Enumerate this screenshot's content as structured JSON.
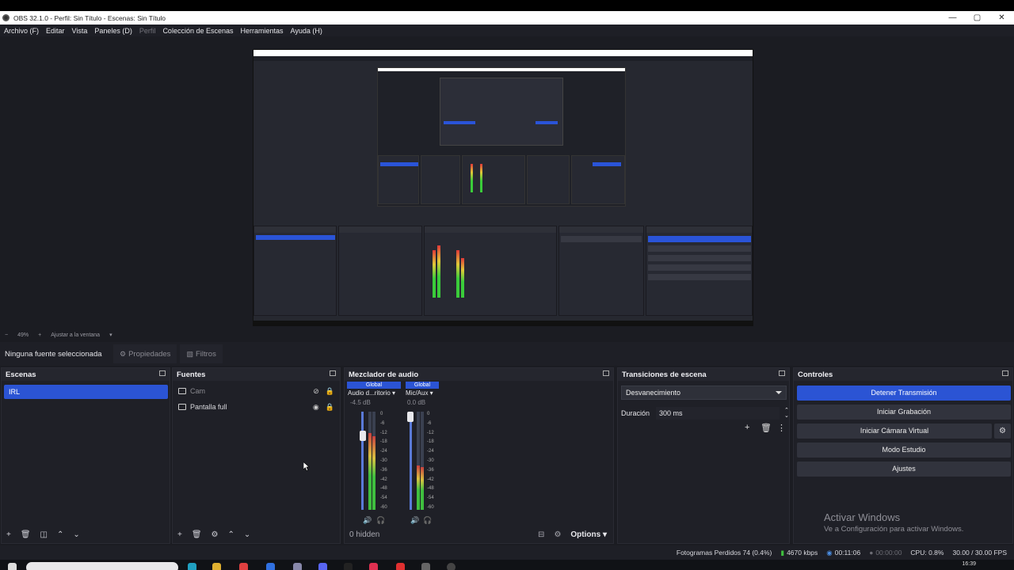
{
  "window": {
    "title": "OBS 32.1.0 - Perfil: Sin Título - Escenas: Sin Título",
    "controls": [
      "—",
      "▢",
      "✕"
    ]
  },
  "menu": [
    {
      "label": "Archivo (F)",
      "disabled": false
    },
    {
      "label": "Editar",
      "disabled": false
    },
    {
      "label": "Vista",
      "disabled": false
    },
    {
      "label": "Paneles (D)",
      "disabled": false
    },
    {
      "label": "Perfil",
      "disabled": true
    },
    {
      "label": "Colección de Escenas",
      "disabled": false
    },
    {
      "label": "Herramientas",
      "disabled": false
    },
    {
      "label": "Ayuda (H)",
      "disabled": false
    }
  ],
  "zoom": {
    "minus": "−",
    "level": "49%",
    "plus": "+",
    "fit_label": "Ajustar a la ventana"
  },
  "properties_bar": {
    "no_source": "Ninguna fuente seleccionada",
    "properties": "Propiedades",
    "filters": "Filtros"
  },
  "scenes": {
    "title": "Escenas",
    "items": [
      "IRL"
    ]
  },
  "sources": {
    "title": "Fuentes",
    "items": [
      {
        "name": "Cam",
        "visible": false
      },
      {
        "name": "Pantalla full",
        "visible": true
      }
    ]
  },
  "mixer": {
    "title": "Mezclador de audio",
    "channels": [
      {
        "tag": "Global",
        "name": "Audio d...ritorio",
        "db": "-4.5 dB",
        "level": 0.78,
        "fader": 0.76
      },
      {
        "tag": "Global",
        "name": "Mic/Aux",
        "db": "0.0 dB",
        "level": 0.45,
        "fader": 0.95
      }
    ],
    "scale": [
      "0",
      "-6",
      "-12",
      "-18",
      "-24",
      "-30",
      "-36",
      "-42",
      "-48",
      "-54",
      "-60"
    ],
    "hidden_label": "0 hidden",
    "options_label": "Options"
  },
  "transitions": {
    "title": "Transiciones de escena",
    "selected": "Desvanecimiento",
    "duration_label": "Duración",
    "duration_value": "300 ms"
  },
  "controls": {
    "title": "Controles",
    "buttons": [
      {
        "label": "Detener Transmisión",
        "active": true
      },
      {
        "label": "Iniciar Grabación",
        "active": false
      },
      {
        "label": "Iniciar Cámara Virtual",
        "active": false
      },
      {
        "label": "Modo Estudio",
        "active": false
      },
      {
        "label": "Ajustes",
        "active": false
      }
    ]
  },
  "watermark": {
    "line1": "Activar Windows",
    "line2": "Ve a Configuración para activar Windows."
  },
  "status": {
    "dropped": "Fotogramas Perdidos 74 (0.4%)",
    "bitrate": "4670 kbps",
    "stream_time": "00:11:06",
    "rec_time": "00:00:00",
    "cpu": "CPU: 0.8%",
    "fps": "30.00 / 30.00 FPS"
  },
  "taskbar": {
    "clock": "16:39"
  },
  "colors": {
    "accent": "#2b54d4",
    "bg": "#1b1c22",
    "dock": "#1f2027"
  }
}
